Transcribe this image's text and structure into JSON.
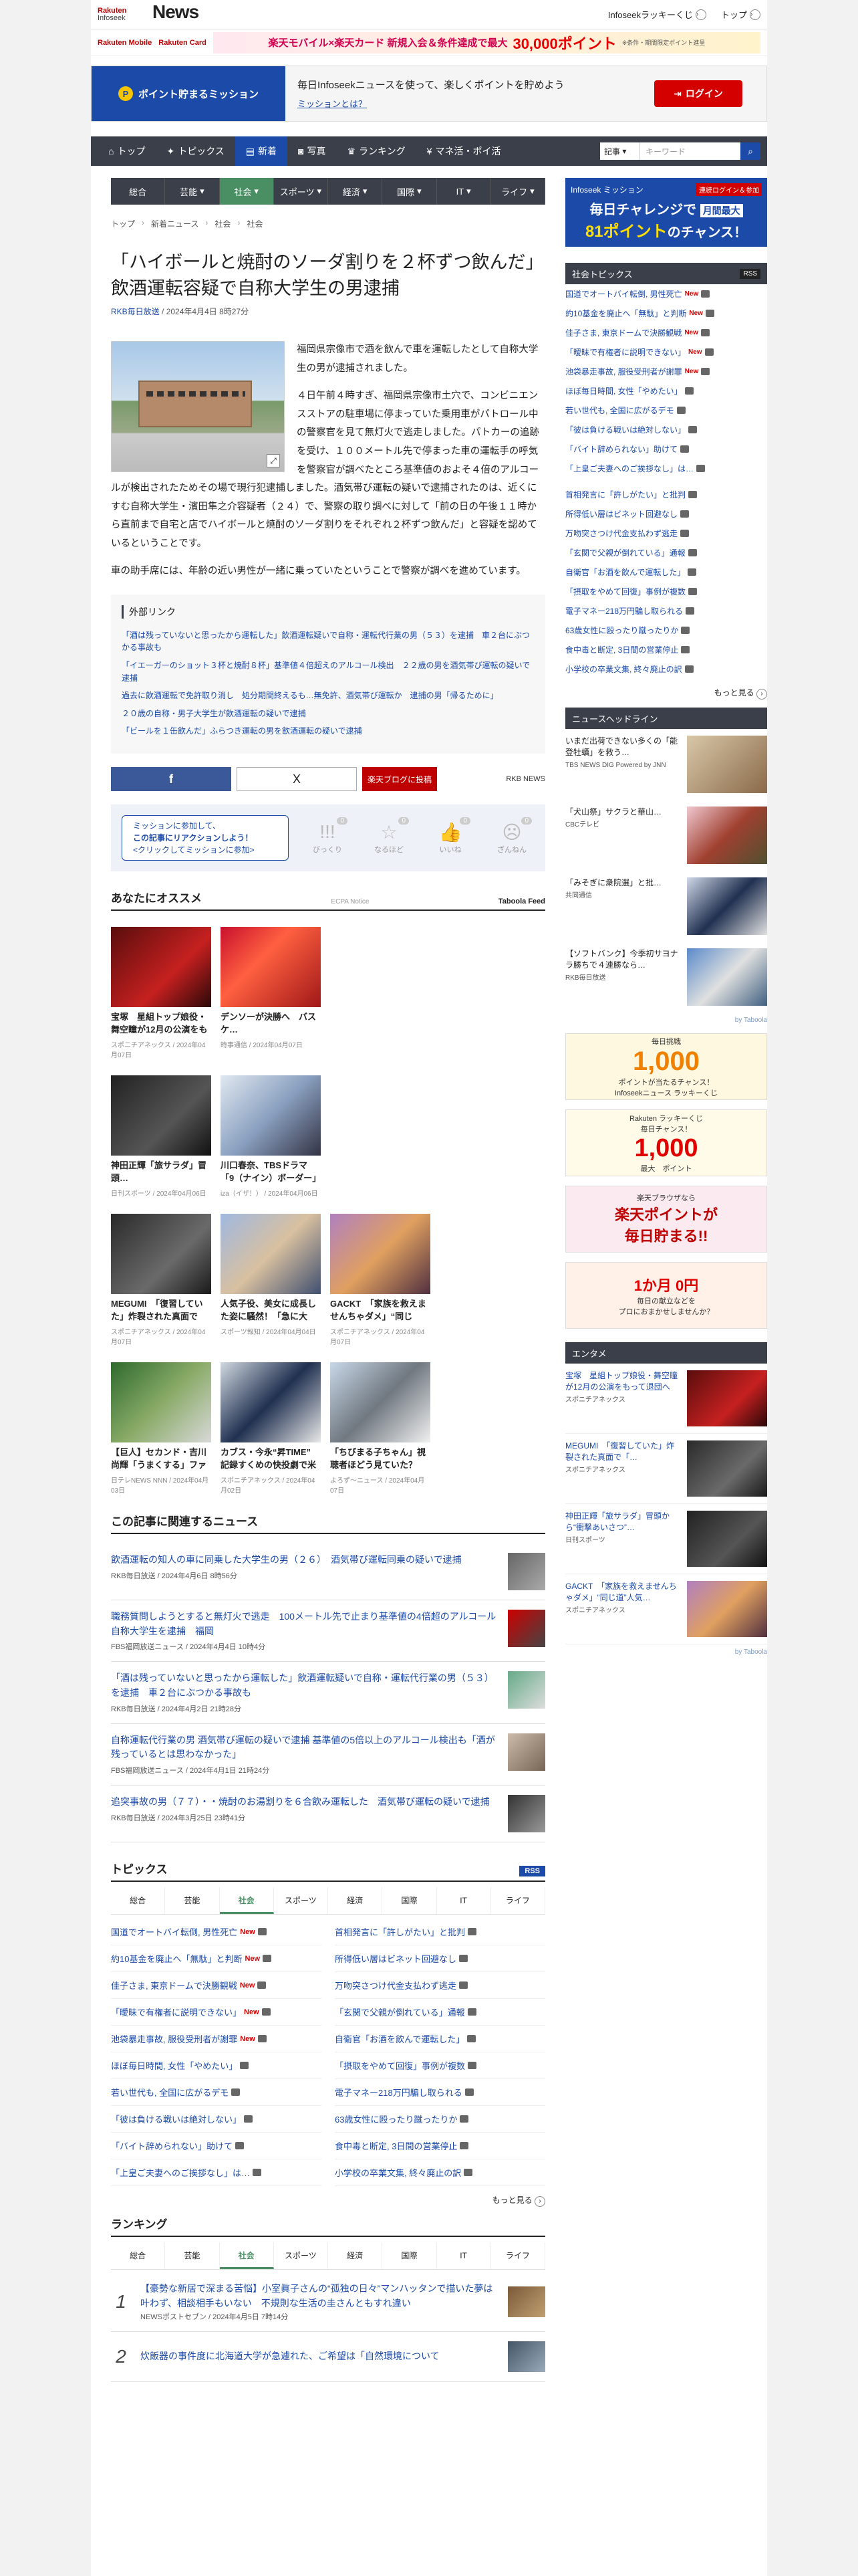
{
  "header": {
    "logo_brand": "Rakuten",
    "logo_sub": "Infoseek",
    "logo_news": "News",
    "lucky_label": "Infoseekラッキーくじ",
    "top_label": "トップ"
  },
  "promo": {
    "brand1": "Rakuten Mobile",
    "brand2": "Rakuten Card",
    "ad_text": "楽天モバイル×楽天カード 新規入会＆条件達成で最大",
    "ad_big": "30,000ポイント",
    "ad_small": "※条件・期間限定ポイント進呈"
  },
  "mission": {
    "button_label": "ポイント貯まるミッション",
    "text": "毎日Infoseekニュースを使って、楽しくポイントを貯めよう",
    "sub": "ミッションとは？",
    "login": "ログイン"
  },
  "mainnav": {
    "items": [
      "トップ",
      "トピックス",
      "新着",
      "写真",
      "ランキング",
      "マネ活・ポイ活"
    ],
    "select": "記事",
    "placeholder": "キーワード"
  },
  "subnav": {
    "items": [
      "総合",
      "芸能",
      "社会",
      "スポーツ",
      "経済",
      "国際",
      "IT",
      "ライフ"
    ]
  },
  "breadcrumb": [
    "トップ",
    "新着ニュース",
    "社会",
    "社会"
  ],
  "article": {
    "title": "「ハイボールと焼酎のソーダ割りを２杯ずつ飲んだ」飲酒運転容疑で自称大学生の男逮捕",
    "source": "RKB毎日放送",
    "date": "/ 2024年4月4日 8時27分",
    "p1": "福岡県宗像市で酒を飲んで車を運転したとして自称大学生の男が逮捕されました。",
    "p2": "４日午前４時すぎ、福岡県宗像市土穴で、コンビニエンスストアの駐車場に停まっていた乗用車がパトロール中の警察官を見て無灯火で逃走しました。パトカーの追跡を受け、１００メートル先で停まった車の運転手の呼気を警察官が調べたところ基準値のおよそ４倍のアルコールが検出されたためその場で現行犯逮捕しました。酒気帯び運転の疑いで逮捕されたのは、近くにすむ自称大学生・濱田隼之介容疑者（２４）で、警察の取り調べに対して「前の日の午後１１時から直前まで自宅と店でハイボールと焼酎のソーダ割りをそれぞれ２杯ずつ飲んだ」と容疑を認めているということです。",
    "p3": "車の助手席には、年齢の近い男性が一緒に乗っていたということで警察が調べを進めています。"
  },
  "extlinks": {
    "title": "外部リンク",
    "items": [
      "「酒は残っていないと思ったから運転した」飲酒運転疑いで自称・運転代行業の男（５３）を逮捕　車２台にぶつかる事故も",
      "「イエーガーのショット３杯と焼酎８杯」基準値４倍超えのアルコール検出　２２歳の男を酒気帯び運転の疑いで逮捕",
      "過去に飲酒運転で免許取り消し　処分期間終えるも…無免許、酒気帯び運転か　逮捕の男「帰るために」",
      "２０歳の自称・男子大学生が飲酒運転の疑いで逮捕",
      "「ビールを１缶飲んだ」ふらつき運転の男を飲酒運転の疑いで逮捕"
    ]
  },
  "share": {
    "fb": "f",
    "x": "X",
    "rblog": "楽天ブログに投稿",
    "news_brand": "RKB NEWS"
  },
  "reaction": {
    "line1": "ミッションに参加して、",
    "line2": "この記事にリアクションしよう！",
    "line3": "<クリックしてミッションに参加>",
    "buttons": [
      {
        "label": "びっくり",
        "count": "0",
        "icon": "!!!"
      },
      {
        "label": "なるほど",
        "count": "0",
        "icon": "☆"
      },
      {
        "label": "いいね",
        "count": "0",
        "icon": "👍"
      },
      {
        "label": "ざんねん",
        "count": "0",
        "icon": "☹"
      }
    ]
  },
  "recommend": {
    "title": "あなたにオススメ",
    "notice": "ECPA Notice",
    "feed": "Taboola Feed",
    "cards": [
      {
        "t": "宝塚　星組トップ娘役・舞空瞳が12月の公演をもっ…",
        "s": "スポニチアネックス / 2024年04月07日"
      },
      {
        "t": "デンソーが決勝へ　バスケ…",
        "s": "時事通信 / 2024年04月07日"
      },
      {
        "t": "神田正輝「旅サラダ」冒頭…",
        "s": "日刊スポーツ / 2024年04月06日"
      },
      {
        "t": "川口春奈、TBSドラマ「9（ナイン）ボーダー」で共…",
        "s": "iza（イザ！） / 2024年04月06日"
      },
      {
        "t": "MEGUMI　「復習していた」炸裂された真面で「衆…",
        "s": "スポニチアネックス / 2024年04月07日"
      },
      {
        "t": "人気子役、美女に成長した姿に騒然！「急に大人」…",
        "s": "スポーツ報知 / 2024年04月04日"
      },
      {
        "t": "GACKT　「家族を救えませんちゃダメ」“同じ道”人気…",
        "s": "スポニチアネックス / 2024年04月07日"
      },
      {
        "t": "【巨人】セカンド・吉川尚輝「うまくする」ファイン…",
        "s": "日テレNEWS NNN / 2024年04月03日"
      },
      {
        "t": "カブス・今永“昇TIME”　記録すくめの快投劇で米1勝…",
        "s": "スポニチアネックス / 2024年04月02日"
      },
      {
        "t": "「ちびまる子ちゃん」視聴者ほどう見ていた？TARA…",
        "s": "よろず〜ニュース / 2024年04月07日"
      }
    ]
  },
  "related": {
    "title": "この記事に関連するニュース",
    "items": [
      {
        "t": "飲酒運転の知人の車に同乗した大学生の男（２６）　酒気帯び運転同乗の疑いで逮捕",
        "s": "RKB毎日放送 / 2024年4月6日 8時56分"
      },
      {
        "t": "職務質問しようとすると無灯火で逃走　100メートル先で止まり基準値の4倍超のアルコール　自称大学生を逮捕　福岡",
        "s": "FBS福岡放送ニュース / 2024年4月4日 10時4分"
      },
      {
        "t": "「酒は残っていないと思ったから運転した」飲酒運転疑いで自称・運転代行業の男（５３）を逮捕　車２台にぶつかる事故も",
        "s": "RKB毎日放送 / 2024年4月2日 21時28分"
      },
      {
        "t": "自称運転代行業の男 酒気帯び運転の疑いで逮捕 基準値の5倍以上のアルコール検出も「酒が残っているとは思わなかった」",
        "s": "FBS福岡放送ニュース / 2024年4月1日 21時24分"
      },
      {
        "t": "追突事故の男（７７）・・焼酎のお湯割りを６合飲み運転した　酒気帯び運転の疑いで逮捕",
        "s": "RKB毎日放送 / 2024年3月25日 23時41分"
      }
    ]
  },
  "topics": {
    "title": "トピックス",
    "rss": "RSS",
    "tabs": [
      "総合",
      "芸能",
      "社会",
      "スポーツ",
      "経済",
      "国際",
      "IT",
      "ライフ"
    ],
    "left": [
      {
        "t": "国道でオートバイ転倒, 男性死亡",
        "new": "New"
      },
      {
        "t": "約10基金を廃止へ「無駄」と判断",
        "new": "New"
      },
      {
        "t": "佳子さま, 東京ドームで決勝観戦",
        "new": "New"
      },
      {
        "t": "「曖昧で有権者に説明できない」",
        "new": "New"
      },
      {
        "t": "池袋暴走事故, 服役受刑者が謝罪",
        "new": "New"
      },
      {
        "t": "ほぼ毎日時間, 女性「やめたい」",
        "new": ""
      },
      {
        "t": "若い世代も, 全国に広がるデモ",
        "new": ""
      },
      {
        "t": "「彼は負ける戦いは絶対しない」",
        "new": ""
      },
      {
        "t": "「バイト辞められない」助けて",
        "new": ""
      },
      {
        "t": "「上皇ご夫妻へのご挨拶なし」は…",
        "new": ""
      }
    ],
    "right": [
      {
        "t": "首相発言に「許しがたい」と批判",
        "new": ""
      },
      {
        "t": "所得低い層はビネット回避なし",
        "new": ""
      },
      {
        "t": "万吻突さつけ代金支払わず逃走",
        "new": ""
      },
      {
        "t": "「玄関で父親が倒れている」通報",
        "new": ""
      },
      {
        "t": "自衛官「お酒を飲んで運転した」",
        "new": ""
      },
      {
        "t": "「摂取をやめて回復」事例が複数",
        "new": ""
      },
      {
        "t": "電子マネー218万円騙し取られる",
        "new": ""
      },
      {
        "t": "63歳女性に殴ったり蹴ったりか",
        "new": ""
      },
      {
        "t": "食中毒と断定, 3日間の営業停止",
        "new": ""
      },
      {
        "t": "小学校の卒業文集, 終々廃止の訳",
        "new": ""
      }
    ],
    "more": "もっと見る"
  },
  "ranking": {
    "title": "ランキング",
    "tabs": [
      "総合",
      "芸能",
      "社会",
      "スポーツ",
      "経済",
      "国際",
      "IT",
      "ライフ"
    ],
    "items": [
      {
        "n": "1",
        "t": "【豪勢な新居で深まる苦悩】小室眞子さんの“孤独の日々”マンハッタンで描いた夢は叶わず、相談相手もいない　不規則な生活の圭さんともすれ違い",
        "s": "NEWSポストセブン / 2024年4月5日 7時14分"
      },
      {
        "n": "2",
        "t": "炊飯器の事件度に北海道大学が急遽れた、ご希望は「自然環境について",
        "s": ""
      }
    ]
  },
  "sidebar": {
    "ad1": {
      "l1": "Infoseek ミッション",
      "l1r": "連続ログイン＆参加",
      "l2": "毎日チャレンジで",
      "l3a": "81ポイント",
      "l3b": "のチャンス！",
      "badge": "月間最大"
    },
    "topics_title": "社会トピックス",
    "rss": "RSS",
    "topics": [
      {
        "t": "国道でオートバイ転倒, 男性死亡",
        "new": "New"
      },
      {
        "t": "約10基金を廃止へ「無駄」と判断",
        "new": "New"
      },
      {
        "t": "佳子さま, 東京ドームで決勝観戦",
        "new": "New"
      },
      {
        "t": "「曖昧で有権者に説明できない」",
        "new": "New"
      },
      {
        "t": "池袋暴走事故, 服役受刑者が謝罪",
        "new": "New"
      },
      {
        "t": "ほぼ毎日時間, 女性「やめたい」",
        "new": ""
      },
      {
        "t": "若い世代も, 全国に広がるデモ",
        "new": ""
      },
      {
        "t": "「彼は負ける戦いは絶対しない」",
        "new": ""
      },
      {
        "t": "「バイト辞められない」助けて",
        "new": ""
      },
      {
        "t": "「上皇ご夫妻へのご挨拶なし」は…",
        "new": ""
      }
    ],
    "topics2": [
      "首相発言に「許しがたい」と批判",
      "所得低い層はビネット回避なし",
      "万吻突さつけ代金支払わず逃走",
      "「玄関で父親が倒れている」通報",
      "自衛官「お酒を飲んで運転した」",
      "「摂取をやめて回復」事例が複数",
      "電子マネー218万円騙し取られる",
      "63歳女性に殴ったり蹴ったりか",
      "食中毒と断定, 3日間の営業停止",
      "小学校の卒業文集, 終々廃止の訳"
    ],
    "more": "もっと見る",
    "headline_title": "ニュースヘッドライン",
    "headlines": [
      {
        "t": "いまだ出荷できない多くの「能登牡蠣」を救う…",
        "s": "TBS NEWS DIG Powered by JNN"
      },
      {
        "t": "「犬山祭」サクラと華山…",
        "s": "CBCテレビ"
      },
      {
        "t": "「みそぎに衆院選」と批…",
        "s": "共同通信"
      },
      {
        "t": "【ソフトバンク】今季初サヨナラ勝ちで４連勝なら…",
        "s": "RKB毎日放送"
      }
    ],
    "by": "by Taboola",
    "ad_a": {
      "l1": "Infoseekニュース ラッキーくじ",
      "big": "1,000",
      "l2": "ポイントが当たるチャンス！",
      "tag": "毎日挑戦"
    },
    "ad_b": {
      "l1": "Rakuten ラッキーくじ",
      "big": "1,000",
      "l2": "最大　ポイント",
      "tag": "毎日チャンス！"
    },
    "ad_c": {
      "l1": "楽天ブラウザなら",
      "l2": "楽天ポイントが",
      "l3": "毎日貯まる!!"
    },
    "ad_d": {
      "l1": "1か月 0円",
      "l2": "毎日の献立などを",
      "l3": "プロにおまかせしませんか？"
    },
    "ent_title": "エンタメ",
    "ent": [
      {
        "t": "宝塚　星組トップ娘役・舞空瞳が12月の公演をもって退団へ",
        "s": "スポニチアネックス"
      },
      {
        "t": "MEGUMI　「復習していた」炸裂された真面で「…",
        "s": "スポニチアネックス"
      },
      {
        "t": "神田正輝「旅サラダ」冒頭から“衝撃あいさつ”…",
        "s": "日刊スポーツ"
      },
      {
        "t": "GACKT　「家族を救えませんちゃダメ」“同じ道”人気…",
        "s": "スポニチアネックス"
      }
    ],
    "by2": "by Taboola"
  }
}
